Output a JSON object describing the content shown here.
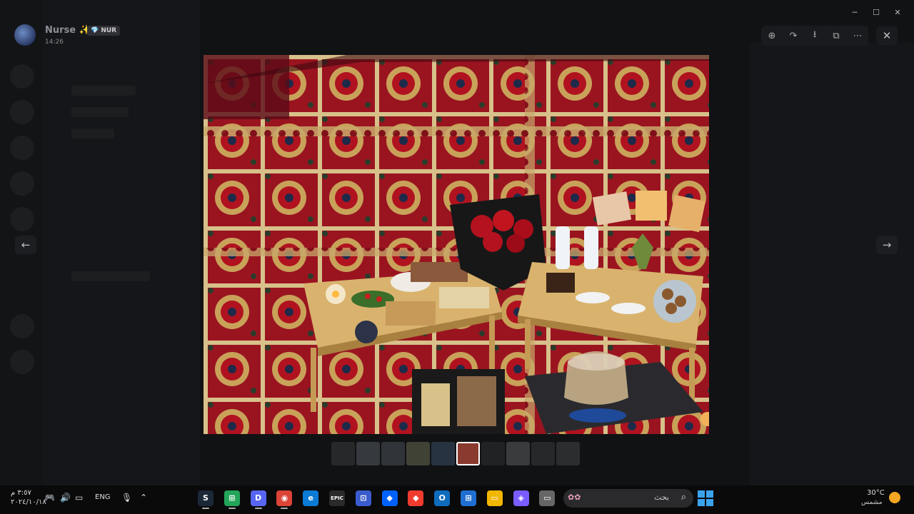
{
  "window": {
    "minimize": "─",
    "maximize": "☐",
    "close": "✕"
  },
  "viewer": {
    "username": "Nurse ✨",
    "tag": "💎 NUR",
    "timestamp": "14:26",
    "tools": {
      "zoom": "⊕",
      "forward": "↷",
      "download": "⭳",
      "open_external": "⧉",
      "more": "⋯"
    },
    "close": "✕",
    "prev": "←",
    "next": "→",
    "thumbnail_count": 10,
    "active_thumbnail": 5
  },
  "taskbar": {
    "clock_time": "٣:٥٧ م",
    "clock_date": "٢٠٢٤/١٠/١٨",
    "language": "ENG",
    "search_placeholder": "بحث",
    "weather_temp": "30°C",
    "weather_desc": "مشمس",
    "apps": [
      {
        "name": "steam",
        "label": "S",
        "color": "#1b2838"
      },
      {
        "name": "app-green",
        "label": "⊞",
        "color": "#23a55a"
      },
      {
        "name": "discord",
        "label": "D",
        "color": "#5865f2"
      },
      {
        "name": "chrome",
        "label": "◉",
        "color": "#db4437"
      },
      {
        "name": "edge",
        "label": "e",
        "color": "#0c7bd6"
      },
      {
        "name": "epic",
        "label": "EPIC",
        "color": "#2a2a2a"
      },
      {
        "name": "app-blue",
        "label": "⊡",
        "color": "#3a5ccc"
      },
      {
        "name": "dropbox",
        "label": "◆",
        "color": "#0061fe"
      },
      {
        "name": "git",
        "label": "◆",
        "color": "#f03c2e"
      },
      {
        "name": "outlook",
        "label": "O",
        "color": "#0f6cbd"
      },
      {
        "name": "store",
        "label": "⊞",
        "color": "#1f6fd1"
      },
      {
        "name": "explorer",
        "label": "▭",
        "color": "#f2b705"
      },
      {
        "name": "copilot",
        "label": "◈",
        "color": "#7a5cff"
      },
      {
        "name": "app-white",
        "label": "▭",
        "color": "#666"
      }
    ]
  }
}
